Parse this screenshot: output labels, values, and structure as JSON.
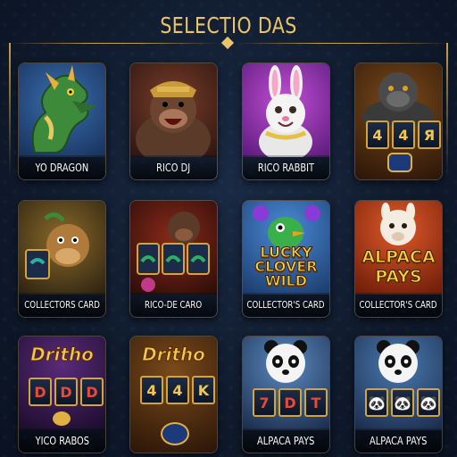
{
  "header": {
    "title": "SELECTIO DAS"
  },
  "colors": {
    "gold": "#e9c46a",
    "background": "#122038"
  },
  "games": [
    {
      "label": "YO DRAGON",
      "icon": "dragon-icon"
    },
    {
      "label": "RICO DJ",
      "icon": "gorilla-icon"
    },
    {
      "label": "RICO RABBIT",
      "icon": "rabbit-icon"
    },
    {
      "label": "",
      "icon": "gorilla-slot-icon",
      "reels": [
        "4",
        "4",
        "Я"
      ]
    },
    {
      "label": "COLLECTORS CARD",
      "icon": "creature-slot-icon"
    },
    {
      "label": "RICO-DE CARO",
      "icon": "gorilla-slot-icon"
    },
    {
      "label": "COLLECTOR'S CARD",
      "icon": "bird-icon",
      "title_lines": [
        "LUCKY",
        "CLOVER",
        "WILD"
      ]
    },
    {
      "label": "COLLECTOR'S CARD",
      "icon": "alpaca-icon",
      "title_lines": [
        "ALPACA",
        "PAYS"
      ]
    },
    {
      "label": "YICO RABOS",
      "icon": "slot-machine-icon",
      "logo": "Dritho",
      "reels": [
        "D",
        "D",
        "D"
      ]
    },
    {
      "label": "",
      "icon": "slot-machine-icon",
      "logo": "Dritho",
      "reels": [
        "4",
        "4",
        "K"
      ]
    },
    {
      "label": "ALPACA PAYS",
      "icon": "panda-icon",
      "reels": [
        "7",
        "D",
        "T"
      ]
    },
    {
      "label": "ALPACA PAYS",
      "icon": "panda-icon"
    }
  ]
}
